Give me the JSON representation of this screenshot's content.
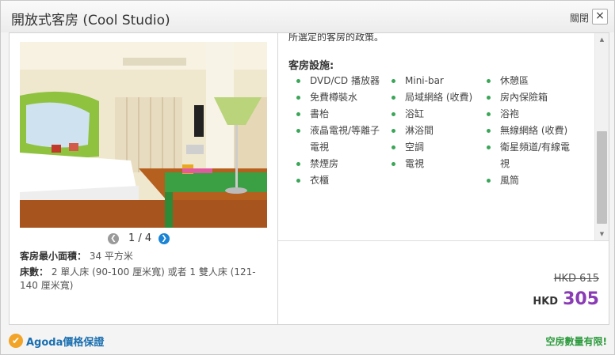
{
  "dialog": {
    "title": "開放式客房 (Cool Studio)",
    "close_label": "關閉",
    "close_glyph": "×"
  },
  "gallery": {
    "counter": "1 / 4",
    "prev_glyph": "❮",
    "next_glyph": "❯"
  },
  "room_info": {
    "area_label": "客房最小面積：",
    "area_value": "34 平方米",
    "bed_label": "床數：",
    "bed_value": "2 單人床 (90-100 厘米寬) 或者 1 雙人床 (121-140 厘米寬)"
  },
  "policy_text": "所選定的客房的政策。",
  "facilities": {
    "title": "客房設施:",
    "col1": [
      "DVD/CD 播放器",
      "免費樽裝水",
      "書枱",
      "液晶電視/等離子電視",
      "禁煙房",
      "衣櫃"
    ],
    "col2": [
      "Mini-bar",
      "局域網絡 (收費)",
      "浴缸",
      "淋浴間",
      "空調",
      "電視"
    ],
    "col3": [
      "休憩區",
      "房內保險箱",
      "浴袍",
      "無線網絡 (收費)",
      "衛星頻道/有線電視",
      "風筒"
    ]
  },
  "pricing": {
    "old_price": "HKD 615",
    "currency": "HKD",
    "new_price": "305"
  },
  "footer": {
    "guarantee_link": "Agoda價格保證",
    "limited_text": "空房數量有限!"
  },
  "colors": {
    "accent_green": "#3aa657",
    "price_purple": "#8a3cb5",
    "link_blue": "#1a6fb0",
    "badge_orange": "#f2a428"
  }
}
